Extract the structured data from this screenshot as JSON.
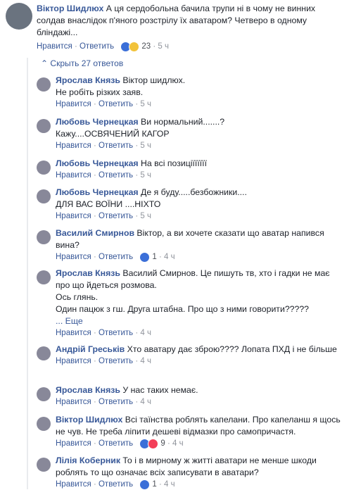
{
  "main": {
    "author": "Віктор Шидлюх",
    "text": "А ця сердобольна бачила трупи ні в чому не винних солдав внаслідок п'яного розстрілу їх аватаром? Четверо в одному бліндажі...",
    "like_label": "Нравится",
    "reply_label": "Ответить",
    "reactions": "23",
    "time": "5 ч"
  },
  "hide_replies": "Скрыть 27 ответов",
  "more_label": "... Еще",
  "replies": [
    {
      "author": "Ярослав Князь",
      "text": "Віктор шидлюх.\nНе робіть різких заяв.",
      "time": "5 ч",
      "reactions": ""
    },
    {
      "author": "Любовь Чернецкая",
      "text": "Ви нормальний.......?\nКажу....ОСВЯЧЕНИЙ КАГОР",
      "time": "5 ч",
      "reactions": ""
    },
    {
      "author": "Любовь Чернецкая",
      "text": "На всі позиціїїїїїї",
      "time": "5 ч",
      "reactions": ""
    },
    {
      "author": "Любовь Чернецкая",
      "text": "Де я буду.....безбожники....\nДЛЯ ВАС ВОЇНИ ....НІХТО",
      "time": "5 ч",
      "reactions": ""
    },
    {
      "author": "Василий Смирнов",
      "text": "Віктор, а ви хочете сказати що аватар напився вина?",
      "time": "4 ч",
      "reactions": "1"
    },
    {
      "author": "Ярослав Князь",
      "text": "Василий Смирнов. Це пишуть тв, хто і гадки не має про що йдеться розмова.\nОсь глянь.\nОдин пацюк з гш. Друга штабна. Про що з ними говорити?????",
      "time": "4 ч",
      "reactions": ""
    },
    {
      "author": "Андрій Греськів",
      "text": "Хто аватару дає зброю???? Лопата ПХД і не більше",
      "time": "4 ч",
      "reactions": ""
    },
    {
      "author": "Ярослав Князь",
      "text": "У нас таких немає.",
      "time": "4 ч",
      "reactions": ""
    },
    {
      "author": "Віктор Шидлюх",
      "text": "Всі таїнства роблять капелани. Про капеланш я щось не чув. Не треба ліпити дешеві відмазки про самопричастя.",
      "time": "4 ч",
      "reactions": "9"
    },
    {
      "author": "Лілія Коберник",
      "text": "То і в мирному ж житті аватари не менше шкоди роблять то що означає всіх записувати в аватари?",
      "time": "4 ч",
      "reactions": "1"
    }
  ]
}
